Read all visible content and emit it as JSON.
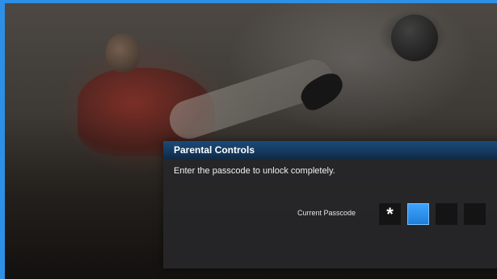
{
  "dialog": {
    "title": "Parental Controls",
    "instruction": "Enter the passcode to unlock completely."
  },
  "passcode": {
    "label": "Current Passcode",
    "digits": [
      "*",
      "",
      "",
      ""
    ],
    "active_index": 1
  },
  "colors": {
    "accent": "#2e8fe6",
    "header": "#1c4a78",
    "active_digit": "#3ea3ff"
  }
}
